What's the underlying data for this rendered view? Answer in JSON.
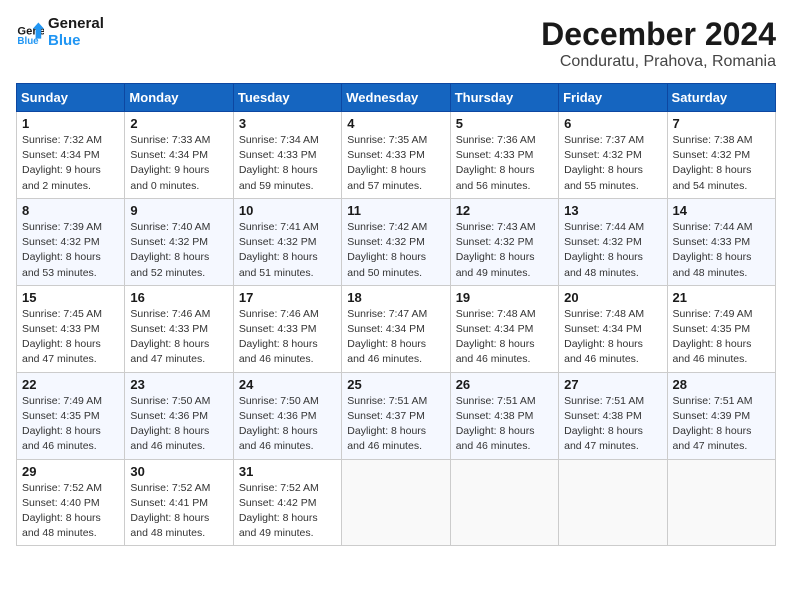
{
  "header": {
    "logo_line1": "General",
    "logo_line2": "Blue",
    "main_title": "December 2024",
    "subtitle": "Conduratu, Prahova, Romania"
  },
  "calendar": {
    "weekdays": [
      "Sunday",
      "Monday",
      "Tuesday",
      "Wednesday",
      "Thursday",
      "Friday",
      "Saturday"
    ],
    "weeks": [
      [
        {
          "day": "1",
          "sunrise": "7:32 AM",
          "sunset": "4:34 PM",
          "daylight": "9 hours and 2 minutes."
        },
        {
          "day": "2",
          "sunrise": "7:33 AM",
          "sunset": "4:34 PM",
          "daylight": "9 hours and 0 minutes."
        },
        {
          "day": "3",
          "sunrise": "7:34 AM",
          "sunset": "4:33 PM",
          "daylight": "8 hours and 59 minutes."
        },
        {
          "day": "4",
          "sunrise": "7:35 AM",
          "sunset": "4:33 PM",
          "daylight": "8 hours and 57 minutes."
        },
        {
          "day": "5",
          "sunrise": "7:36 AM",
          "sunset": "4:33 PM",
          "daylight": "8 hours and 56 minutes."
        },
        {
          "day": "6",
          "sunrise": "7:37 AM",
          "sunset": "4:32 PM",
          "daylight": "8 hours and 55 minutes."
        },
        {
          "day": "7",
          "sunrise": "7:38 AM",
          "sunset": "4:32 PM",
          "daylight": "8 hours and 54 minutes."
        }
      ],
      [
        {
          "day": "8",
          "sunrise": "7:39 AM",
          "sunset": "4:32 PM",
          "daylight": "8 hours and 53 minutes."
        },
        {
          "day": "9",
          "sunrise": "7:40 AM",
          "sunset": "4:32 PM",
          "daylight": "8 hours and 52 minutes."
        },
        {
          "day": "10",
          "sunrise": "7:41 AM",
          "sunset": "4:32 PM",
          "daylight": "8 hours and 51 minutes."
        },
        {
          "day": "11",
          "sunrise": "7:42 AM",
          "sunset": "4:32 PM",
          "daylight": "8 hours and 50 minutes."
        },
        {
          "day": "12",
          "sunrise": "7:43 AM",
          "sunset": "4:32 PM",
          "daylight": "8 hours and 49 minutes."
        },
        {
          "day": "13",
          "sunrise": "7:44 AM",
          "sunset": "4:32 PM",
          "daylight": "8 hours and 48 minutes."
        },
        {
          "day": "14",
          "sunrise": "7:44 AM",
          "sunset": "4:33 PM",
          "daylight": "8 hours and 48 minutes."
        }
      ],
      [
        {
          "day": "15",
          "sunrise": "7:45 AM",
          "sunset": "4:33 PM",
          "daylight": "8 hours and 47 minutes."
        },
        {
          "day": "16",
          "sunrise": "7:46 AM",
          "sunset": "4:33 PM",
          "daylight": "8 hours and 47 minutes."
        },
        {
          "day": "17",
          "sunrise": "7:46 AM",
          "sunset": "4:33 PM",
          "daylight": "8 hours and 46 minutes."
        },
        {
          "day": "18",
          "sunrise": "7:47 AM",
          "sunset": "4:34 PM",
          "daylight": "8 hours and 46 minutes."
        },
        {
          "day": "19",
          "sunrise": "7:48 AM",
          "sunset": "4:34 PM",
          "daylight": "8 hours and 46 minutes."
        },
        {
          "day": "20",
          "sunrise": "7:48 AM",
          "sunset": "4:34 PM",
          "daylight": "8 hours and 46 minutes."
        },
        {
          "day": "21",
          "sunrise": "7:49 AM",
          "sunset": "4:35 PM",
          "daylight": "8 hours and 46 minutes."
        }
      ],
      [
        {
          "day": "22",
          "sunrise": "7:49 AM",
          "sunset": "4:35 PM",
          "daylight": "8 hours and 46 minutes."
        },
        {
          "day": "23",
          "sunrise": "7:50 AM",
          "sunset": "4:36 PM",
          "daylight": "8 hours and 46 minutes."
        },
        {
          "day": "24",
          "sunrise": "7:50 AM",
          "sunset": "4:36 PM",
          "daylight": "8 hours and 46 minutes."
        },
        {
          "day": "25",
          "sunrise": "7:51 AM",
          "sunset": "4:37 PM",
          "daylight": "8 hours and 46 minutes."
        },
        {
          "day": "26",
          "sunrise": "7:51 AM",
          "sunset": "4:38 PM",
          "daylight": "8 hours and 46 minutes."
        },
        {
          "day": "27",
          "sunrise": "7:51 AM",
          "sunset": "4:38 PM",
          "daylight": "8 hours and 47 minutes."
        },
        {
          "day": "28",
          "sunrise": "7:51 AM",
          "sunset": "4:39 PM",
          "daylight": "8 hours and 47 minutes."
        }
      ],
      [
        {
          "day": "29",
          "sunrise": "7:52 AM",
          "sunset": "4:40 PM",
          "daylight": "8 hours and 48 minutes."
        },
        {
          "day": "30",
          "sunrise": "7:52 AM",
          "sunset": "4:41 PM",
          "daylight": "8 hours and 48 minutes."
        },
        {
          "day": "31",
          "sunrise": "7:52 AM",
          "sunset": "4:42 PM",
          "daylight": "8 hours and 49 minutes."
        },
        null,
        null,
        null,
        null
      ]
    ]
  }
}
